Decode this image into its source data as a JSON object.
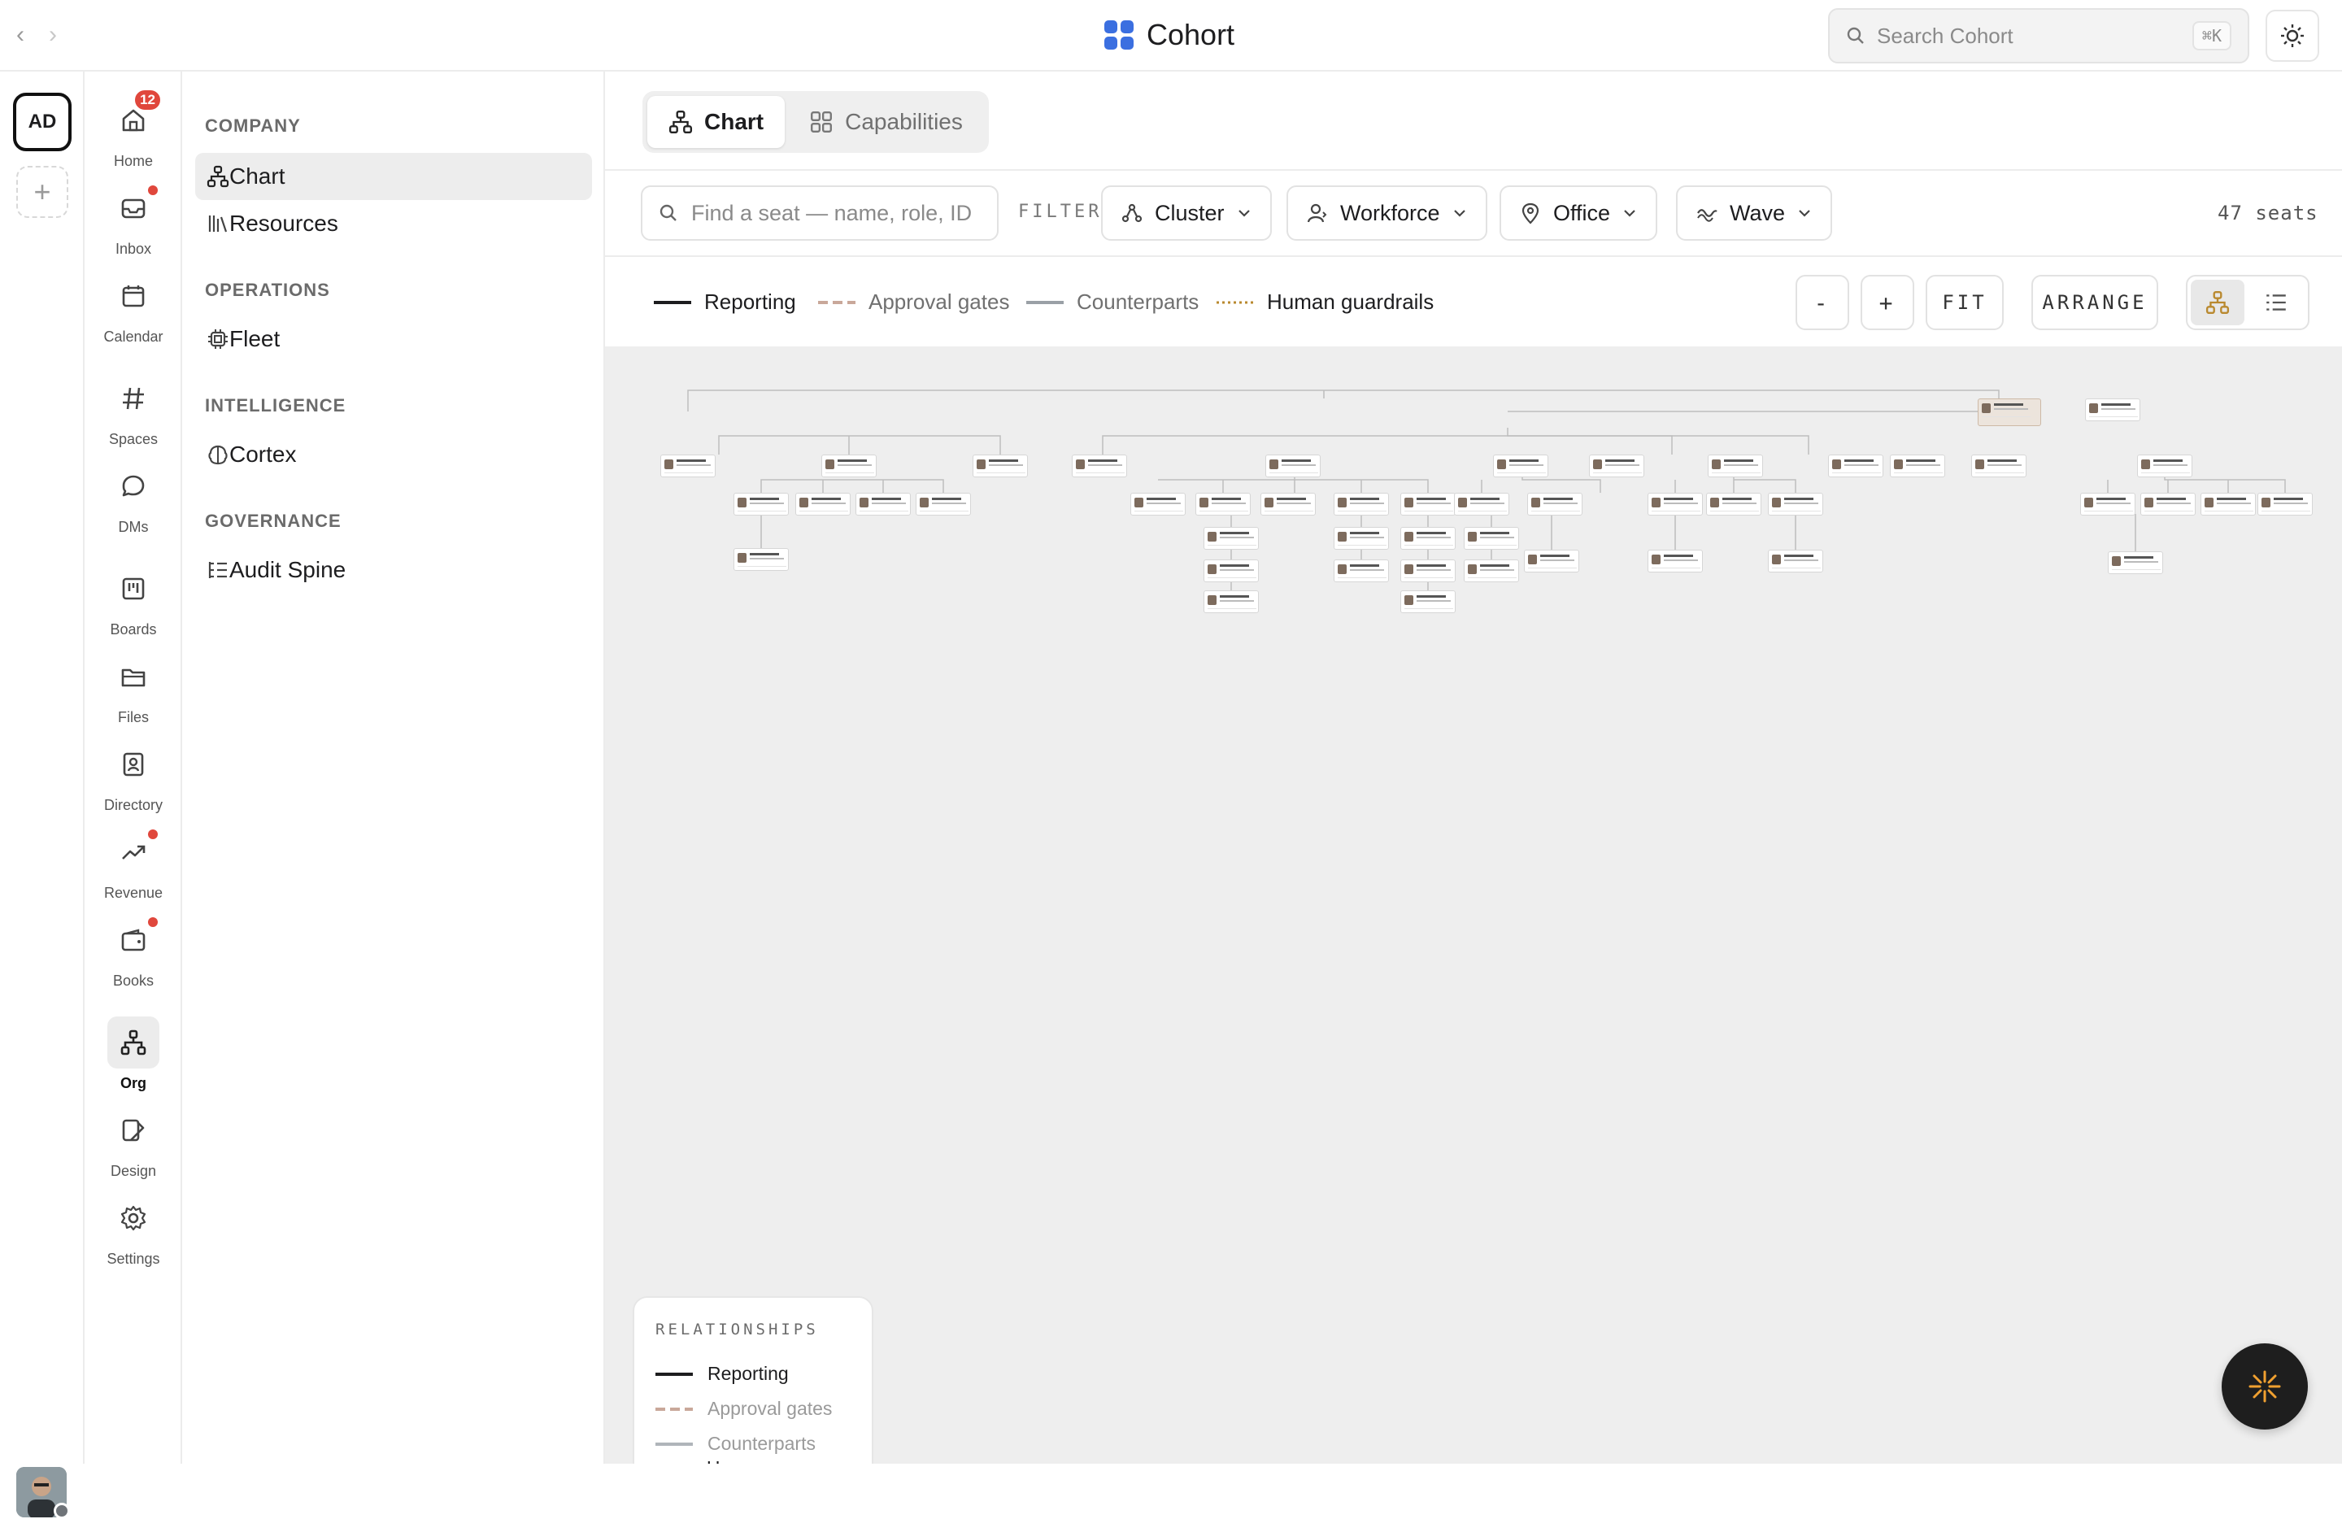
{
  "app": {
    "title": "Cohort",
    "search_placeholder": "Search Cohort",
    "search_shortcut": "⌘K"
  },
  "workspace": {
    "initials": "AD"
  },
  "nav": {
    "items": [
      {
        "id": "home",
        "label": "Home",
        "icon": "home-icon",
        "badge": "12"
      },
      {
        "id": "inbox",
        "label": "Inbox",
        "icon": "inbox-icon",
        "dot": true
      },
      {
        "id": "calendar",
        "label": "Calendar",
        "icon": "calendar-icon"
      },
      {
        "id": "spaces",
        "label": "Spaces",
        "icon": "hash-icon"
      },
      {
        "id": "dms",
        "label": "DMs",
        "icon": "chat-bubble-icon"
      },
      {
        "id": "boards",
        "label": "Boards",
        "icon": "board-icon"
      },
      {
        "id": "files",
        "label": "Files",
        "icon": "folder-icon"
      },
      {
        "id": "directory",
        "label": "Directory",
        "icon": "contact-card-icon"
      },
      {
        "id": "revenue",
        "label": "Revenue",
        "icon": "trend-up-icon",
        "dot": true
      },
      {
        "id": "books",
        "label": "Books",
        "icon": "wallet-icon",
        "dot": true
      },
      {
        "id": "org",
        "label": "Org",
        "icon": "org-chart-icon",
        "active": true
      },
      {
        "id": "design",
        "label": "Design",
        "icon": "design-icon"
      },
      {
        "id": "settings",
        "label": "Settings",
        "icon": "gear-icon"
      }
    ]
  },
  "sidebar": {
    "sections": [
      {
        "heading": "COMPANY",
        "items": [
          {
            "label": "Chart",
            "icon": "org-chart-icon",
            "active": true
          },
          {
            "label": "Resources",
            "icon": "library-icon"
          }
        ]
      },
      {
        "heading": "OPERATIONS",
        "items": [
          {
            "label": "Fleet",
            "icon": "chip-icon"
          }
        ]
      },
      {
        "heading": "INTELLIGENCE",
        "items": [
          {
            "label": "Cortex",
            "icon": "brain-icon"
          }
        ]
      },
      {
        "heading": "GOVERNANCE",
        "items": [
          {
            "label": "Audit Spine",
            "icon": "list-tree-icon"
          }
        ]
      }
    ]
  },
  "tabs": [
    {
      "label": "Chart",
      "icon": "org-chart-icon",
      "active": true
    },
    {
      "label": "Capabilities",
      "icon": "grid-icon"
    }
  ],
  "filters": {
    "seat_search_placeholder": "Find a seat — name, role, ID",
    "label": "FILTER",
    "dropdowns": [
      {
        "label": "Cluster",
        "icon": "cluster-icon"
      },
      {
        "label": "Workforce",
        "icon": "person-icon"
      },
      {
        "label": "Office",
        "icon": "pin-icon"
      },
      {
        "label": "Wave",
        "icon": "wave-icon"
      }
    ],
    "seat_count": "47 seats"
  },
  "legend": {
    "items": [
      {
        "label": "Reporting",
        "style": "solid",
        "color": "#1d1d1f"
      },
      {
        "label": "Approval gates",
        "style": "dashed",
        "color": "#c9a89a"
      },
      {
        "label": "Counterparts",
        "style": "solid",
        "color": "#9aa0a6"
      },
      {
        "label": "Human guardrails",
        "style": "dotted",
        "color": "#b9892f"
      }
    ]
  },
  "controls": {
    "zoom_out": "-",
    "zoom_in": "+",
    "fit": "FIT",
    "arrange": "ARRANGE"
  },
  "relationships": {
    "heading": "RELATIONSHIPS",
    "items": [
      {
        "label": "Reporting",
        "style": "solid",
        "color": "#1d1d1f",
        "dim": false
      },
      {
        "label": "Approval gates",
        "style": "dashed",
        "color": "#c9a89a",
        "dim": true
      },
      {
        "label": "Counterparts",
        "style": "solid",
        "color": "#9aa0a6",
        "dim": true
      },
      {
        "label": "Human guardrails",
        "style": "dotted",
        "color": "#b9892f",
        "dim": false
      }
    ]
  },
  "colors": {
    "accent": "#e0473c",
    "brand": "#3b6fe0",
    "fab_icon": "#f0a030"
  }
}
